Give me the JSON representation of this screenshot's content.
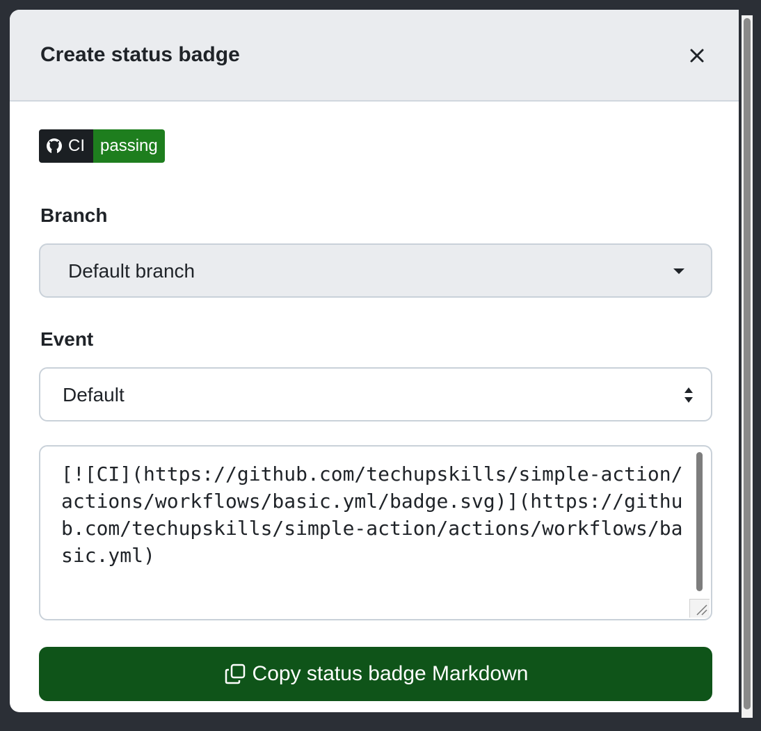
{
  "dialog": {
    "title": "Create status badge",
    "close_icon": "close-icon"
  },
  "badge": {
    "label": "CI",
    "status": "passing",
    "icon": "github-icon",
    "colors": {
      "label_bg": "#1b1f23",
      "status_bg": "#1e7e1e"
    }
  },
  "branch": {
    "label": "Branch",
    "selected": "Default branch"
  },
  "event": {
    "label": "Event",
    "selected": "Default"
  },
  "markdown": {
    "value": "[![CI](https://github.com/techupskills/simple-action/actions/workflows/basic.yml/badge.svg)](https://github.com/techupskills/simple-action/actions/workflows/basic.yml)"
  },
  "copy_button": {
    "label": "Copy status badge Markdown",
    "icon": "copy-icon",
    "color": "#0f5419"
  }
}
